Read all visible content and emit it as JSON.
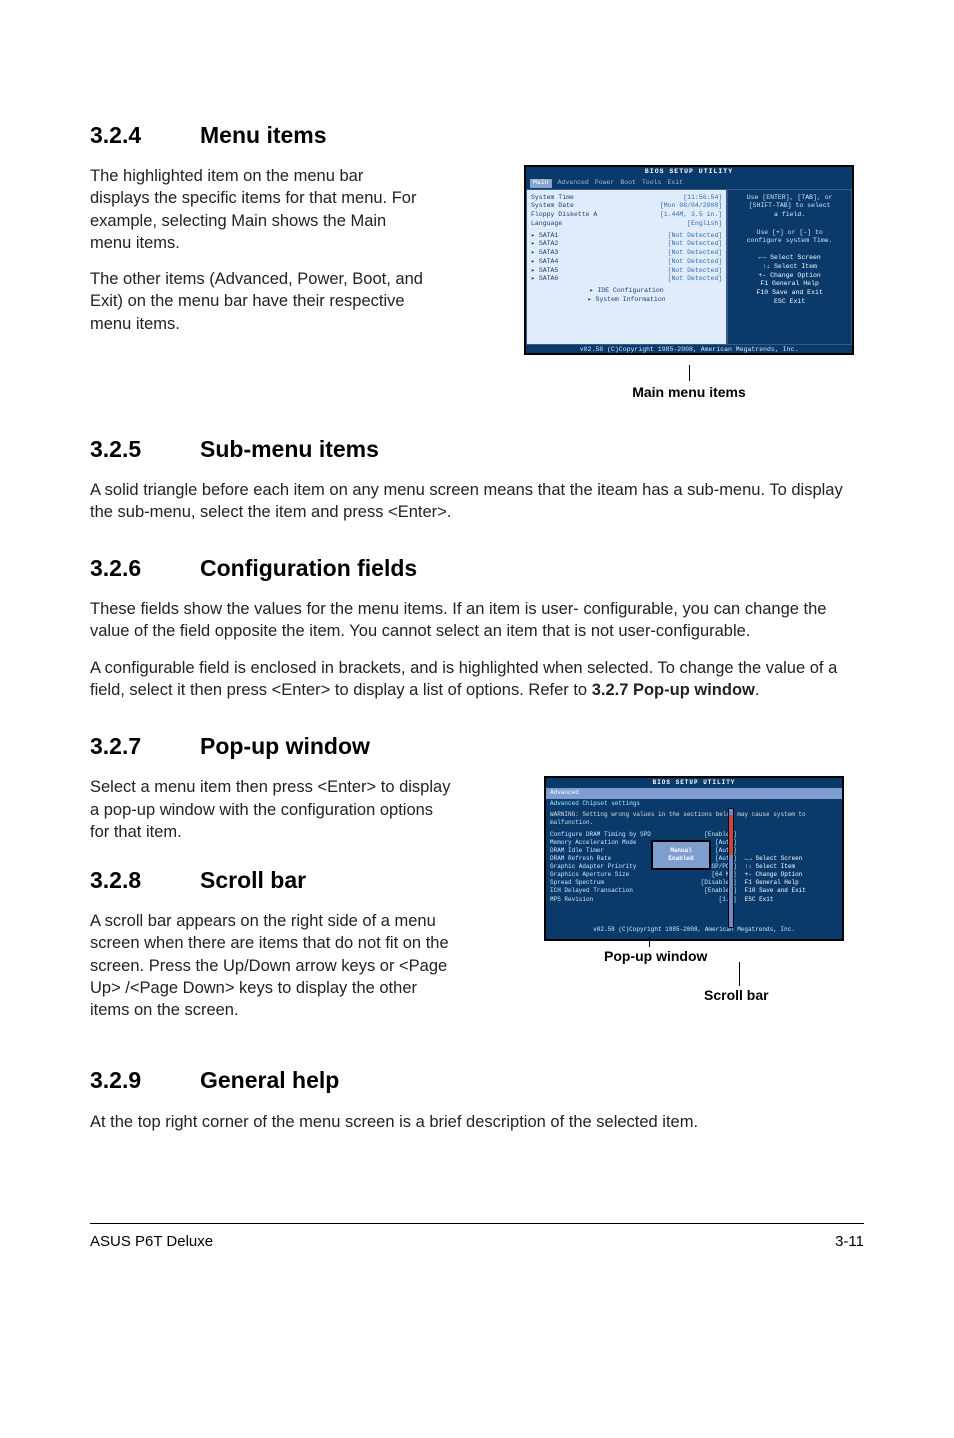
{
  "sections": {
    "s324": {
      "num": "3.2.4",
      "title": "Menu items"
    },
    "s325": {
      "num": "3.2.5",
      "title": "Sub-menu items"
    },
    "s326": {
      "num": "3.2.6",
      "title": "Configuration fields"
    },
    "s327": {
      "num": "3.2.7",
      "title": "Pop-up window"
    },
    "s328": {
      "num": "3.2.8",
      "title": "Scroll bar"
    },
    "s329": {
      "num": "3.2.9",
      "title": "General help"
    }
  },
  "paragraphs": {
    "p324a": "The highlighted item on the menu bar displays the specific items for that menu. For example, selecting Main shows the Main menu items.",
    "p324b": "The other items (Advanced, Power, Boot, and Exit) on the menu bar have their respective menu items.",
    "p325": "A solid triangle before each item on any menu screen means that the iteam has a sub-menu. To display the sub-menu, select the item and press <Enter>.",
    "p326a": "These fields show the values for the menu items. If an item is user- configurable, you can change the value of the field opposite the item. You cannot select an item that is not user-configurable.",
    "p326b_pre": "A configurable field is enclosed in brackets, and is highlighted when selected. To change the value of a field, select it then press <Enter> to display a list of options. Refer to ",
    "p326b_bold": "3.2.7 Pop-up window",
    "p326b_post": ".",
    "p327": "Select a menu item then press <Enter> to display a pop-up window with the configuration options for that item.",
    "p328": "A scroll bar appears on the right side of a menu screen when there are items that do not fit on the screen. Press the Up/Down arrow keys or <Page Up> /<Page Down> keys to display the other items on the screen.",
    "p329": "At the top right corner of the menu screen is a brief description of the selected item."
  },
  "captions": {
    "mainmenu": "Main menu items",
    "popup": "Pop-up window",
    "scrollbar": "Scroll bar"
  },
  "bios1": {
    "title": "BIOS SETUP UTILITY",
    "menubar": [
      "Main",
      "Advanced",
      "Power",
      "Boot",
      "Tools",
      "Exit"
    ],
    "rows": [
      {
        "label": "System Time",
        "value": "[11:56:54]"
      },
      {
        "label": "System Date",
        "value": "[Mon 08/04/2008]"
      },
      {
        "label": "Floppy Diskette A",
        "value": "[1.44M, 3.5 in.]"
      },
      {
        "label": "Language",
        "value": "[English]"
      }
    ],
    "sata": [
      {
        "label": "SATA1",
        "value": "[Not Detected]"
      },
      {
        "label": "SATA2",
        "value": "[Not Detected]"
      },
      {
        "label": "SATA3",
        "value": "[Not Detected]"
      },
      {
        "label": "SATA4",
        "value": "[Not Detected]"
      },
      {
        "label": "SATA5",
        "value": "[Not Detected]"
      },
      {
        "label": "SATA6",
        "value": "[Not Detected]"
      }
    ],
    "subitems": [
      "IDE Configuration",
      "System Information"
    ],
    "help": [
      "Use [ENTER], [TAB], or",
      "[SHIFT-TAB] to select",
      "a field.",
      "",
      "Use [+] or [-] to",
      "configure system Time."
    ],
    "keys": [
      "←→    Select Screen",
      "↑↓    Select Item",
      "+-    Change Option",
      "F1    General Help",
      "F10   Save and Exit",
      "ESC   Exit"
    ],
    "footer": "v02.58 (C)Copyright 1985-2008, American Megatrends, Inc."
  },
  "bios2": {
    "title": "BIOS SETUP UTILITY",
    "menubar_selected": "Advanced",
    "heading": "Advanced Chipset settings",
    "warning": "WARNING: Setting wrong values in the sections below may cause system to malfunction.",
    "rows": [
      {
        "label": "Configure DRAM Timing by SPD",
        "value": "[Enabled]"
      },
      {
        "label": "Memory Acceleration Mode",
        "value": "[Auto]"
      },
      {
        "label": "DRAM Idle Timer",
        "value": "[Auto]"
      },
      {
        "label": "DRAM Refresh Rate",
        "value": "[Auto]"
      },
      {
        "label": "Graphic Adapter Priority",
        "value": "[AGP/PCI]"
      },
      {
        "label": "Graphics Aperture Size",
        "value": "[64 MB]"
      },
      {
        "label": "Spread Spectrum",
        "value": "[Disabled]"
      },
      {
        "label": "ICH Delayed Transaction",
        "value": "[Enabled]"
      },
      {
        "label": "MPS Revision",
        "value": "[1.4]"
      }
    ],
    "popup_options": [
      "Manual",
      "Enabled"
    ],
    "keys": [
      "←→    Select Screen",
      "↑↓    Select Item",
      "+-    Change Option",
      "F1    General Help",
      "F10   Save and Exit",
      "ESC   Exit"
    ],
    "footer": "v02.58 (C)Copyright 1985-2008, American Megatrends, Inc."
  },
  "footer": {
    "left": "ASUS P6T Deluxe",
    "right": "3-11"
  }
}
